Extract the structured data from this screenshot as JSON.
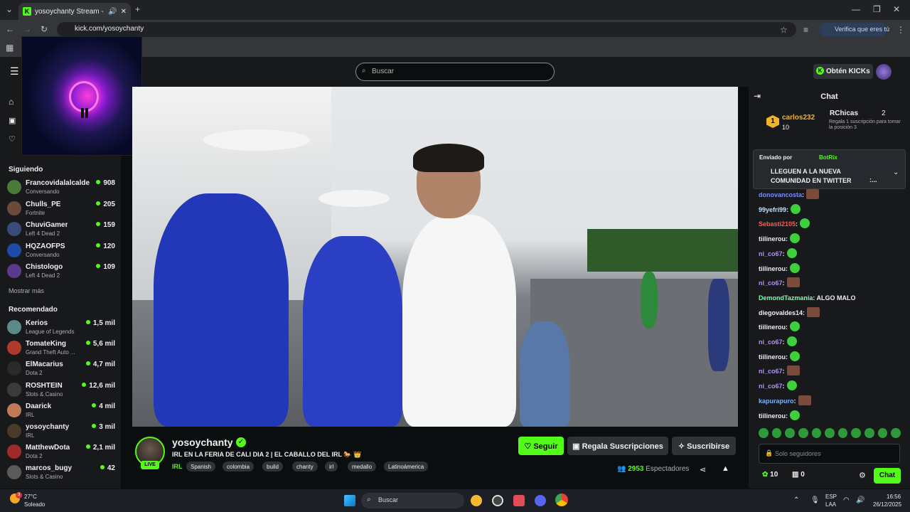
{
  "browser": {
    "tab_title": "yosoychanty Stream - Wat",
    "url": "kick.com/yosoychanty",
    "verify_label": "Verifica que eres tú"
  },
  "header": {
    "search_placeholder": "Buscar",
    "get_kicks_label": "Obtén KICKs"
  },
  "sidebar": {
    "following_title": "Siguiendo",
    "following": [
      {
        "name": "Francovidalalcalde",
        "category": "Conversando",
        "viewers": "908",
        "color": "#4a7a3a"
      },
      {
        "name": "Chulls_PE",
        "category": "Fortnite",
        "viewers": "205",
        "color": "#6a4a3a"
      },
      {
        "name": "ChuviGamer",
        "category": "Left 4 Dead 2",
        "viewers": "159",
        "color": "#3a4a7a"
      },
      {
        "name": "HQZAOFPS",
        "category": "Conversando",
        "viewers": "120",
        "color": "#1e4aa8"
      },
      {
        "name": "Chistologo",
        "category": "Left 4 Dead 2",
        "viewers": "109",
        "color": "#5a3a8a"
      }
    ],
    "show_more": "Mostrar más",
    "recommended_title": "Recomendado",
    "recommended": [
      {
        "name": "Kerios",
        "category": "League of Legends",
        "viewers": "1,5 mil",
        "color": "#5a8a8a"
      },
      {
        "name": "TomateKing",
        "category": "Grand Theft Auto ...",
        "viewers": "5,6 mil",
        "color": "#b03a2a"
      },
      {
        "name": "ElMacarius",
        "category": "Dota 2",
        "viewers": "4,7 mil",
        "color": "#2a2a2a"
      },
      {
        "name": "ROSHTEIN",
        "category": "Slots & Casino",
        "viewers": "12,6 mil",
        "color": "#3a3a3a"
      },
      {
        "name": "Daarick",
        "category": "IRL",
        "viewers": "4 mil",
        "color": "#c07a5a"
      },
      {
        "name": "yosoychanty",
        "category": "IRL",
        "viewers": "3 mil",
        "color": "#4a3a2a"
      },
      {
        "name": "MatthewDota",
        "category": "Dota 2",
        "viewers": "2,1 mil",
        "color": "#a02a2a"
      },
      {
        "name": "marcos_bugy",
        "category": "Slots & Casino",
        "viewers": "42",
        "color": "#5a5a5a"
      }
    ]
  },
  "stream": {
    "streamer": "yosoychanty",
    "live_label": "LIVE",
    "title": "IRL EN LA FERIA DE CALI DIA 2 | EL CABALLO DEL IRL 🐎 👑",
    "category": "IRL",
    "tags": [
      "Spanish",
      "colombia",
      "build",
      "chanty",
      "irl",
      "medallo",
      "Latinoámerica"
    ],
    "follow_label": "Seguir",
    "gift_label": "Regala Suscripciones",
    "subscribe_label": "Suscribirse",
    "viewer_count": "2953",
    "viewers_label": "Espectadores"
  },
  "chat": {
    "title": "Chat",
    "leader_rank": "1",
    "leader_name": "carlos232",
    "leader_count": "10",
    "gifter_name": "RChicas",
    "gifter_count": "2",
    "gifter_note": "Regala 1 suscripción para tomar la posición 3",
    "pinned_by": "Enviado por",
    "pinned_bot": "BotRix",
    "pinned_text": "LLEGUEN A LA NUEVA COMUNIDAD EN TWITTER",
    "pinned_tail": ":...",
    "messages": [
      {
        "user": "donovancosta",
        "text": ":",
        "color": "#7a8cff",
        "emote": "b"
      },
      {
        "user": "99yefri99",
        "text": ":",
        "color": "#c0e0ff",
        "emote": "g"
      },
      {
        "user": "Sebasti2105",
        "text": ":",
        "color": "#ff5a5a",
        "emote": "g"
      },
      {
        "user": "tiilinerou",
        "text": ":",
        "color": "#efeff1",
        "emote": "g"
      },
      {
        "user": "ni_co67",
        "text": ":",
        "color": "#b98cff",
        "emote": "g"
      },
      {
        "user": "tiilinerou",
        "text": ":",
        "color": "#efeff1",
        "emote": "g"
      },
      {
        "user": "ni_co67",
        "text": ":",
        "color": "#b98cff",
        "emote": "b"
      },
      {
        "user": "DemondTazmania",
        "text": ": ALGO MALO",
        "color": "#7affb0",
        "emote": ""
      },
      {
        "user": "diegovaldes14",
        "text": ":",
        "color": "#efeff1",
        "emote": "b"
      },
      {
        "user": "tiilinerou",
        "text": ":",
        "color": "#efeff1",
        "emote": "g"
      },
      {
        "user": "ni_co67",
        "text": ":",
        "color": "#b98cff",
        "emote": "g"
      },
      {
        "user": "tiilinerou",
        "text": ":",
        "color": "#efeff1",
        "emote": "g"
      },
      {
        "user": "ni_co67",
        "text": ":",
        "color": "#b98cff",
        "emote": "b"
      },
      {
        "user": "ni_co67",
        "text": ":",
        "color": "#b98cff",
        "emote": "g"
      },
      {
        "user": "kapurapuro",
        "text": ":",
        "color": "#7ab0ff",
        "emote": "b"
      },
      {
        "user": "tiilinerou",
        "text": ":",
        "color": "#efeff1",
        "emote": "g"
      }
    ],
    "input_placeholder": "Solo seguidores",
    "kicks_count": "10",
    "gift_count": "0",
    "send_label": "Chat"
  },
  "taskbar": {
    "weather_temp": "27°C",
    "weather_desc": "Soleado",
    "weather_badge": "3",
    "search_label": "Buscar",
    "lang_top": "ESP",
    "lang_bottom": "LAA",
    "time": "16:56",
    "date": "26/12/2025"
  }
}
